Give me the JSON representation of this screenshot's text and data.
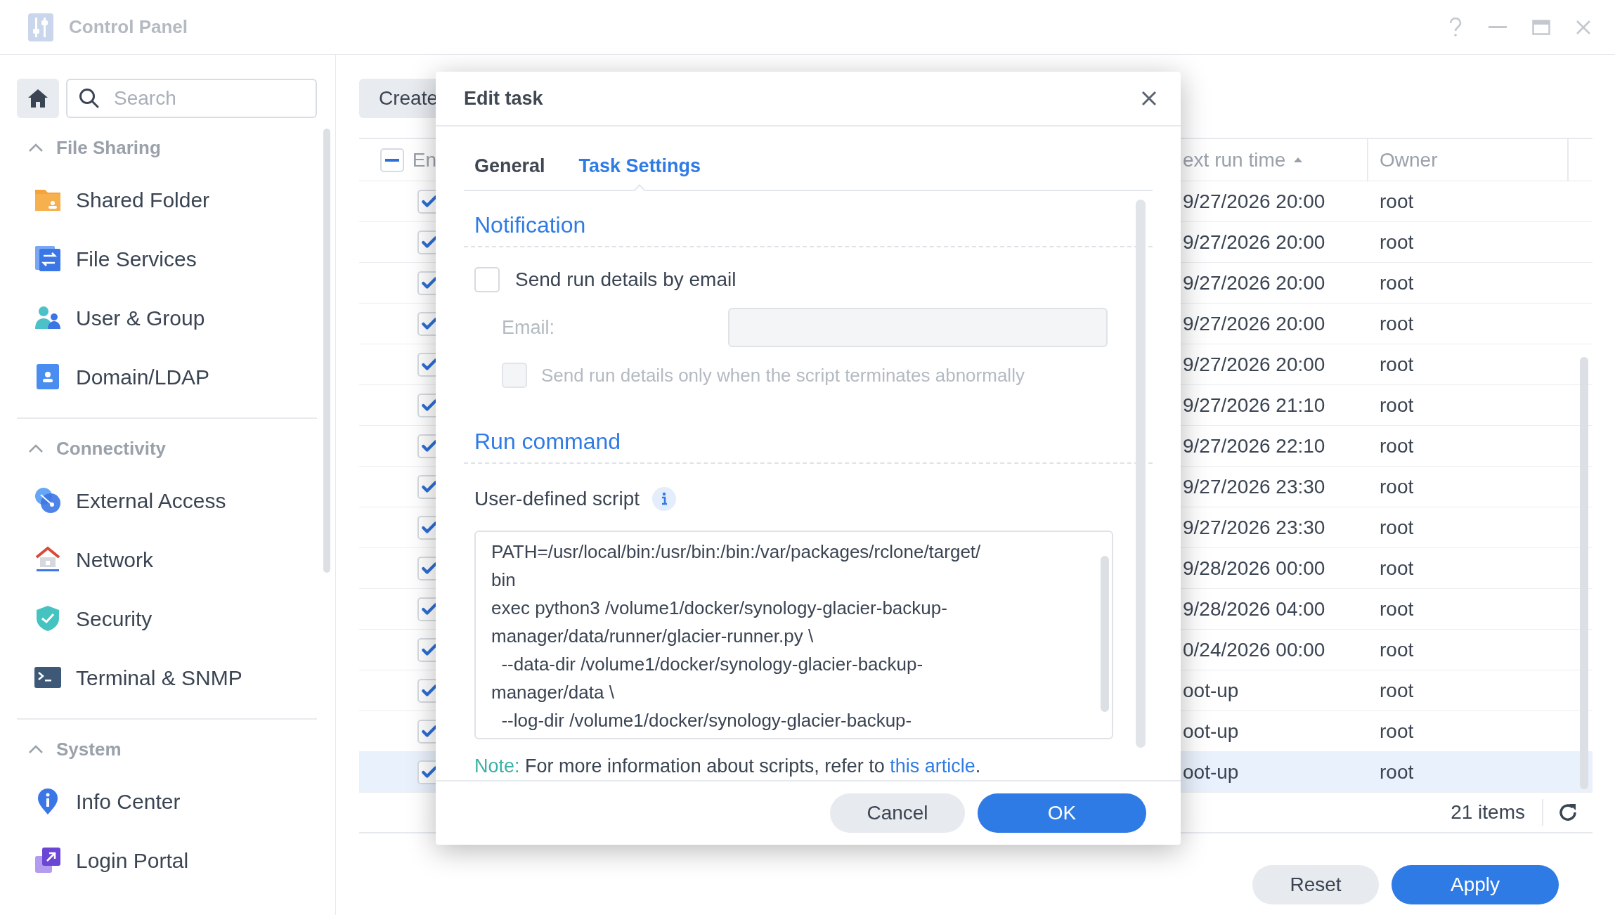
{
  "window": {
    "title": "Control Panel"
  },
  "sidebar": {
    "search": {
      "placeholder": "Search"
    },
    "groups": [
      {
        "label": "File Sharing",
        "expanded": true,
        "items": [
          {
            "label": "Shared Folder",
            "kind": "folder"
          },
          {
            "label": "File Services",
            "kind": "services"
          },
          {
            "label": "User & Group",
            "kind": "users"
          },
          {
            "label": "Domain/LDAP",
            "kind": "domain"
          }
        ]
      },
      {
        "label": "Connectivity",
        "expanded": true,
        "items": [
          {
            "label": "External Access",
            "kind": "external"
          },
          {
            "label": "Network",
            "kind": "network"
          },
          {
            "label": "Security",
            "kind": "security"
          },
          {
            "label": "Terminal & SNMP",
            "kind": "terminal"
          }
        ]
      },
      {
        "label": "System",
        "expanded": true,
        "items": [
          {
            "label": "Info Center",
            "kind": "info"
          },
          {
            "label": "Login Portal",
            "kind": "portal"
          }
        ]
      }
    ]
  },
  "toolbar": {
    "create_button": "Create"
  },
  "table": {
    "header_partial": true,
    "columns": [
      {
        "label": "En"
      },
      {
        "label": "ext run time",
        "sorted_ascending": true
      },
      {
        "label": "Owner"
      }
    ],
    "rows": [
      {
        "enabled": true,
        "next_run": "9/27/2026 20:00",
        "owner": "root",
        "selected": false
      },
      {
        "enabled": true,
        "next_run": "9/27/2026 20:00",
        "owner": "root",
        "selected": false
      },
      {
        "enabled": true,
        "next_run": "9/27/2026 20:00",
        "owner": "root",
        "selected": false
      },
      {
        "enabled": true,
        "next_run": "9/27/2026 20:00",
        "owner": "root",
        "selected": false
      },
      {
        "enabled": true,
        "next_run": "9/27/2026 20:00",
        "owner": "root",
        "selected": false
      },
      {
        "enabled": true,
        "next_run": "9/27/2026 21:10",
        "owner": "root",
        "selected": false
      },
      {
        "enabled": true,
        "next_run": "9/27/2026 22:10",
        "owner": "root",
        "selected": false
      },
      {
        "enabled": true,
        "next_run": "9/27/2026 23:30",
        "owner": "root",
        "selected": false
      },
      {
        "enabled": true,
        "next_run": "9/27/2026 23:30",
        "owner": "root",
        "selected": false
      },
      {
        "enabled": true,
        "next_run": "9/28/2026 00:00",
        "owner": "root",
        "selected": false
      },
      {
        "enabled": true,
        "next_run": "9/28/2026 04:00",
        "owner": "root",
        "selected": false
      },
      {
        "enabled": true,
        "next_run": "0/24/2026 00:00",
        "owner": "root",
        "selected": false
      },
      {
        "enabled": true,
        "next_run": "oot-up",
        "owner": "root",
        "selected": false
      },
      {
        "enabled": true,
        "next_run": "oot-up",
        "owner": "root",
        "selected": false
      },
      {
        "enabled": true,
        "next_run": "oot-up",
        "owner": "root",
        "selected": true
      }
    ],
    "count": "21 items"
  },
  "buttons": [
    {
      "label": "Reset",
      "kind": "secondary"
    },
    {
      "label": "Apply",
      "kind": "primary"
    }
  ],
  "dialog": {
    "title": "Edit task",
    "tabs": [
      {
        "label": "General",
        "selected": false
      },
      {
        "label": "Task Settings",
        "selected": true
      }
    ],
    "notification": {
      "heading": "Notification",
      "email_checkbox": {
        "label": "Send run details by email",
        "checked": false,
        "disabled": false
      },
      "email_label": "Email:",
      "email_disabled": true,
      "abnormal_checkbox": {
        "label": "Send run details only when the script terminates abnormally",
        "checked": false,
        "disabled": true
      }
    },
    "run_command": {
      "heading": "Run command",
      "script_label": "User-defined script",
      "script_lines": [
        "PATH=/usr/local/bin:/usr/bin:/bin:/var/packages/rclone/target/",
        "bin",
        "exec python3 /volume1/docker/synology-glacier-backup-",
        "manager/data/runner/glacier-runner.py \\",
        "  --data-dir /volume1/docker/synology-glacier-backup-",
        "manager/data \\",
        "  --log-dir /volume1/docker/synology-glacier-backup-"
      ],
      "note_label": "Note:",
      "note_text": "For more information about scripts, refer to",
      "note_link": "this article",
      "note_end": "."
    },
    "buttons": [
      {
        "label": "Cancel",
        "kind": "secondary"
      },
      {
        "label": "OK",
        "kind": "primary"
      }
    ]
  }
}
